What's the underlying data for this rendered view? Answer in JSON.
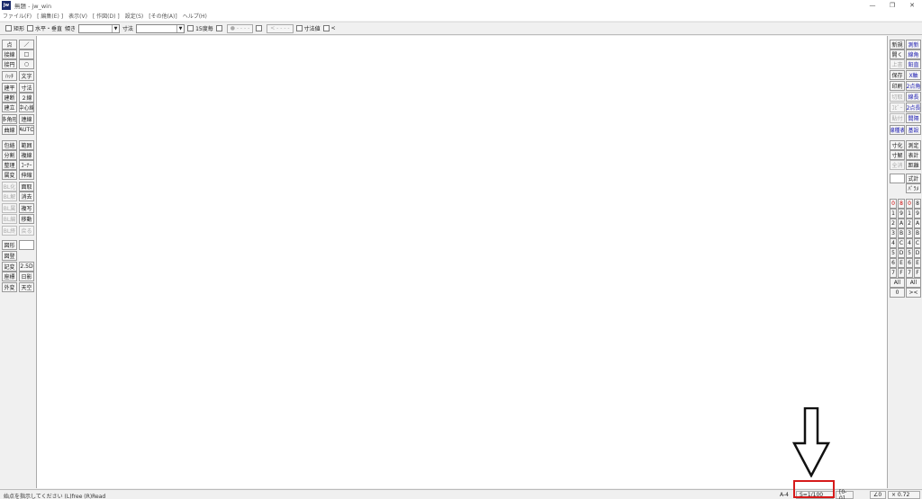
{
  "window": {
    "app_icon": "jw",
    "title": "無題 - jw_win",
    "controls": [
      "—",
      "❐",
      "✕"
    ]
  },
  "menubar": {
    "items": [
      "ファイル(F)",
      "[ 編集(E) ]",
      "表示(V)",
      "[ 作図(D) ]",
      "設定(S)",
      "[その他(A)]",
      "ヘルプ(H)"
    ]
  },
  "toolbar": {
    "rect_label": "矩形",
    "horiz_vert_label": "水平・垂直",
    "tilt_label": "傾き",
    "dim_label": "寸法",
    "deg15_label": "15度毎",
    "circle_btn": "● - - - -",
    "arrow_btn": "< - - - -",
    "dim_value_label": "寸法値",
    "lt_label": "<"
  },
  "left_tools": {
    "col1": [
      "点",
      "接線",
      "接円",
      "ﾊｯﾁ",
      "建平",
      "建断",
      "建立",
      "多角形",
      "曲線",
      "包絡",
      "分割",
      "整理",
      "属変",
      "BL化",
      "BL解",
      "BL属",
      "BL編",
      "BL終",
      "図形",
      "図登",
      "記変",
      "座標",
      "外変"
    ],
    "col2": [
      "／",
      "□",
      "○",
      "文字",
      "寸法",
      "２線",
      "中心線",
      "連線",
      "AUTO",
      "範囲",
      "複線",
      "ｺｰﾅｰ",
      "伸縮",
      "面取",
      "消去",
      "複写",
      "移動",
      "戻る",
      "",
      "2.5D",
      "日影",
      "天空"
    ]
  },
  "right_tools": {
    "col1": [
      "新規",
      "開く",
      "上書",
      "保存",
      "印刷",
      "切取",
      "ｺﾋﾟｰ",
      "貼付",
      "線種表",
      "寸化",
      "寸解",
      "全消",
      "",
      "0",
      "1",
      "2",
      "3",
      "4",
      "5",
      "6",
      "7",
      "All",
      "0"
    ],
    "col2": [
      "測新",
      "線角",
      "鉛直",
      "X軸",
      "2点角",
      "線長",
      "2点長",
      "間隔",
      "基設",
      "測定",
      "表計",
      "距離",
      "式計",
      "ﾊﾟﾗﾒ",
      "0",
      "1",
      "2",
      "3",
      "4",
      "5",
      "6",
      "7",
      "All",
      "><"
    ],
    "col1b": [
      "8",
      "9",
      "A",
      "B",
      "C",
      "D",
      "E",
      "F"
    ],
    "col2b": [
      "8",
      "9",
      "A",
      "B",
      "C",
      "D",
      "E",
      "F"
    ]
  },
  "status": {
    "message": "始点を指示してください (L)free (R)Read",
    "paper": "A-4",
    "scale": "S=1/100",
    "layer": "[0-0]",
    "angle": "∠0",
    "zoom": "× 0.72"
  },
  "colors": {
    "highlight": "#d61a1a",
    "blue_text": "#1a1ab0",
    "red_text": "#cc0000"
  }
}
